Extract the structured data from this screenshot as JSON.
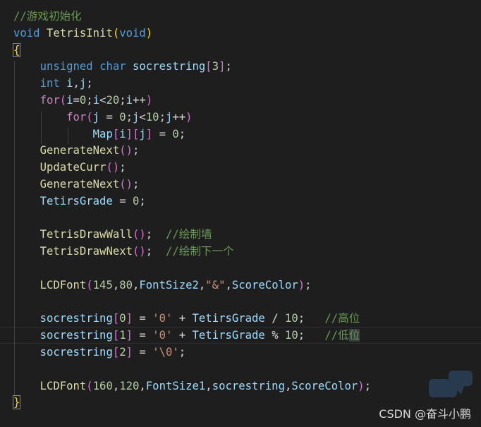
{
  "lines": [
    [
      {
        "t": "//游戏初始化",
        "c": "com"
      }
    ],
    [
      {
        "t": "void",
        "c": "kw"
      },
      {
        "t": " ",
        "c": "pln"
      },
      {
        "t": "TetrisInit",
        "c": "fn"
      },
      {
        "t": "(",
        "c": "br1"
      },
      {
        "t": "void",
        "c": "kw"
      },
      {
        "t": ")",
        "c": "br1"
      }
    ],
    [
      {
        "t": "{",
        "c": "br1",
        "id": "brace-open"
      }
    ],
    [
      {
        "t": "    ",
        "c": "pln"
      },
      {
        "t": "unsigned",
        "c": "kw"
      },
      {
        "t": " ",
        "c": "pln"
      },
      {
        "t": "char",
        "c": "kw"
      },
      {
        "t": " ",
        "c": "pln"
      },
      {
        "t": "socrestring",
        "c": "var"
      },
      {
        "t": "[",
        "c": "br2"
      },
      {
        "t": "3",
        "c": "num"
      },
      {
        "t": "]",
        "c": "br2"
      },
      {
        "t": ";",
        "c": "pun"
      }
    ],
    [
      {
        "t": "    ",
        "c": "pln"
      },
      {
        "t": "int",
        "c": "kw"
      },
      {
        "t": " ",
        "c": "pln"
      },
      {
        "t": "i",
        "c": "var"
      },
      {
        "t": ",",
        "c": "pun"
      },
      {
        "t": "j",
        "c": "var"
      },
      {
        "t": ";",
        "c": "pun"
      }
    ],
    [
      {
        "t": "    ",
        "c": "pln"
      },
      {
        "t": "for",
        "c": "ctl"
      },
      {
        "t": "(",
        "c": "br2"
      },
      {
        "t": "i",
        "c": "var"
      },
      {
        "t": "=",
        "c": "pun"
      },
      {
        "t": "0",
        "c": "num"
      },
      {
        "t": ";",
        "c": "pun"
      },
      {
        "t": "i",
        "c": "var"
      },
      {
        "t": "<",
        "c": "pun"
      },
      {
        "t": "20",
        "c": "num"
      },
      {
        "t": ";",
        "c": "pun"
      },
      {
        "t": "i",
        "c": "var"
      },
      {
        "t": "++",
        "c": "pun"
      },
      {
        "t": ")",
        "c": "br2"
      }
    ],
    [
      {
        "t": "        ",
        "c": "pln"
      },
      {
        "t": "for",
        "c": "ctl"
      },
      {
        "t": "(",
        "c": "br2"
      },
      {
        "t": "j",
        "c": "var"
      },
      {
        "t": " = ",
        "c": "pun"
      },
      {
        "t": "0",
        "c": "num"
      },
      {
        "t": ";",
        "c": "pun"
      },
      {
        "t": "j",
        "c": "var"
      },
      {
        "t": "<",
        "c": "pun"
      },
      {
        "t": "10",
        "c": "num"
      },
      {
        "t": ";",
        "c": "pun"
      },
      {
        "t": "j",
        "c": "var"
      },
      {
        "t": "++",
        "c": "pun"
      },
      {
        "t": ")",
        "c": "br2"
      }
    ],
    [
      {
        "t": "            ",
        "c": "pln"
      },
      {
        "t": "Map",
        "c": "var"
      },
      {
        "t": "[",
        "c": "br2"
      },
      {
        "t": "i",
        "c": "var"
      },
      {
        "t": "]",
        "c": "br2"
      },
      {
        "t": "[",
        "c": "br2"
      },
      {
        "t": "j",
        "c": "var"
      },
      {
        "t": "]",
        "c": "br2"
      },
      {
        "t": " = ",
        "c": "pun"
      },
      {
        "t": "0",
        "c": "num"
      },
      {
        "t": ";",
        "c": "pun"
      }
    ],
    [
      {
        "t": "    ",
        "c": "pln"
      },
      {
        "t": "GenerateNext",
        "c": "fn"
      },
      {
        "t": "(",
        "c": "br2"
      },
      {
        "t": ")",
        "c": "br2"
      },
      {
        "t": ";",
        "c": "pun"
      }
    ],
    [
      {
        "t": "    ",
        "c": "pln"
      },
      {
        "t": "UpdateCurr",
        "c": "fn"
      },
      {
        "t": "(",
        "c": "br2"
      },
      {
        "t": ")",
        "c": "br2"
      },
      {
        "t": ";",
        "c": "pun"
      }
    ],
    [
      {
        "t": "    ",
        "c": "pln"
      },
      {
        "t": "GenerateNext",
        "c": "fn"
      },
      {
        "t": "(",
        "c": "br2"
      },
      {
        "t": ")",
        "c": "br2"
      },
      {
        "t": ";",
        "c": "pun"
      }
    ],
    [
      {
        "t": "    ",
        "c": "pln"
      },
      {
        "t": "TetirsGrade",
        "c": "var"
      },
      {
        "t": " = ",
        "c": "pun"
      },
      {
        "t": "0",
        "c": "num"
      },
      {
        "t": ";",
        "c": "pun"
      }
    ],
    [],
    [
      {
        "t": "    ",
        "c": "pln"
      },
      {
        "t": "TetrisDrawWall",
        "c": "fn"
      },
      {
        "t": "(",
        "c": "br2"
      },
      {
        "t": ")",
        "c": "br2"
      },
      {
        "t": ";  ",
        "c": "pun"
      },
      {
        "t": "//绘制墙",
        "c": "com"
      }
    ],
    [
      {
        "t": "    ",
        "c": "pln"
      },
      {
        "t": "TetrisDrawNext",
        "c": "fn"
      },
      {
        "t": "(",
        "c": "br2"
      },
      {
        "t": ")",
        "c": "br2"
      },
      {
        "t": ";  ",
        "c": "pun"
      },
      {
        "t": "//绘制下一个",
        "c": "com"
      }
    ],
    [],
    [
      {
        "t": "    ",
        "c": "pln"
      },
      {
        "t": "LCDFont",
        "c": "fn"
      },
      {
        "t": "(",
        "c": "br2"
      },
      {
        "t": "145",
        "c": "num"
      },
      {
        "t": ",",
        "c": "pun"
      },
      {
        "t": "80",
        "c": "num"
      },
      {
        "t": ",",
        "c": "pun"
      },
      {
        "t": "FontSize2",
        "c": "var"
      },
      {
        "t": ",",
        "c": "pun"
      },
      {
        "t": "\"&\"",
        "c": "str"
      },
      {
        "t": ",",
        "c": "pun"
      },
      {
        "t": "ScoreColor",
        "c": "var"
      },
      {
        "t": ")",
        "c": "br2"
      },
      {
        "t": ";",
        "c": "pun"
      }
    ],
    [],
    [
      {
        "t": "    ",
        "c": "pln"
      },
      {
        "t": "socrestring",
        "c": "var"
      },
      {
        "t": "[",
        "c": "br2"
      },
      {
        "t": "0",
        "c": "num"
      },
      {
        "t": "]",
        "c": "br2"
      },
      {
        "t": " = ",
        "c": "pun"
      },
      {
        "t": "'0'",
        "c": "str"
      },
      {
        "t": " + ",
        "c": "pun"
      },
      {
        "t": "TetirsGrade",
        "c": "var"
      },
      {
        "t": " / ",
        "c": "pun"
      },
      {
        "t": "10",
        "c": "num"
      },
      {
        "t": ";   ",
        "c": "pun"
      },
      {
        "t": "//高位",
        "c": "com"
      }
    ],
    [
      {
        "t": "    ",
        "c": "pln"
      },
      {
        "t": "socrestring",
        "c": "var"
      },
      {
        "t": "[",
        "c": "br2"
      },
      {
        "t": "1",
        "c": "num"
      },
      {
        "t": "]",
        "c": "br2"
      },
      {
        "t": " = ",
        "c": "pun"
      },
      {
        "t": "'0'",
        "c": "str"
      },
      {
        "t": " + ",
        "c": "pun"
      },
      {
        "t": "TetirsGrade",
        "c": "var"
      },
      {
        "t": " % ",
        "c": "pun"
      },
      {
        "t": "10",
        "c": "num"
      },
      {
        "t": ";   ",
        "c": "pun"
      },
      {
        "t": "//低",
        "c": "com"
      },
      {
        "t": "位",
        "c": "com",
        "id": "word-highlight"
      }
    ],
    [
      {
        "t": "    ",
        "c": "pln"
      },
      {
        "t": "socrestring",
        "c": "var"
      },
      {
        "t": "[",
        "c": "br2"
      },
      {
        "t": "2",
        "c": "num"
      },
      {
        "t": "]",
        "c": "br2"
      },
      {
        "t": " = ",
        "c": "pun"
      },
      {
        "t": "'\\0'",
        "c": "str"
      },
      {
        "t": ";",
        "c": "pun"
      }
    ],
    [],
    [
      {
        "t": "    ",
        "c": "pln"
      },
      {
        "t": "LCDFont",
        "c": "fn"
      },
      {
        "t": "(",
        "c": "br2"
      },
      {
        "t": "160",
        "c": "num"
      },
      {
        "t": ",",
        "c": "pun"
      },
      {
        "t": "120",
        "c": "num"
      },
      {
        "t": ",",
        "c": "pun"
      },
      {
        "t": "FontSize1",
        "c": "var"
      },
      {
        "t": ",",
        "c": "pun"
      },
      {
        "t": "socrestring",
        "c": "var"
      },
      {
        "t": ",",
        "c": "pun"
      },
      {
        "t": "ScoreColor",
        "c": "var"
      },
      {
        "t": ")",
        "c": "br2"
      },
      {
        "t": ";",
        "c": "pun"
      }
    ],
    [
      {
        "t": "}",
        "c": "br1",
        "id": "brace-close"
      }
    ]
  ],
  "watermark": {
    "text": "CSDN @奋斗小鹏"
  },
  "colors": {
    "background": "#1e1e1e",
    "keyword": "#569cd6",
    "control": "#c586c0",
    "function": "#dcdcaa",
    "variable": "#9cdcfe",
    "number": "#b5cea8",
    "string": "#ce9178",
    "comment": "#6a9955",
    "bracket_level1": "#ffd700",
    "bracket_level2": "#da70d6"
  }
}
